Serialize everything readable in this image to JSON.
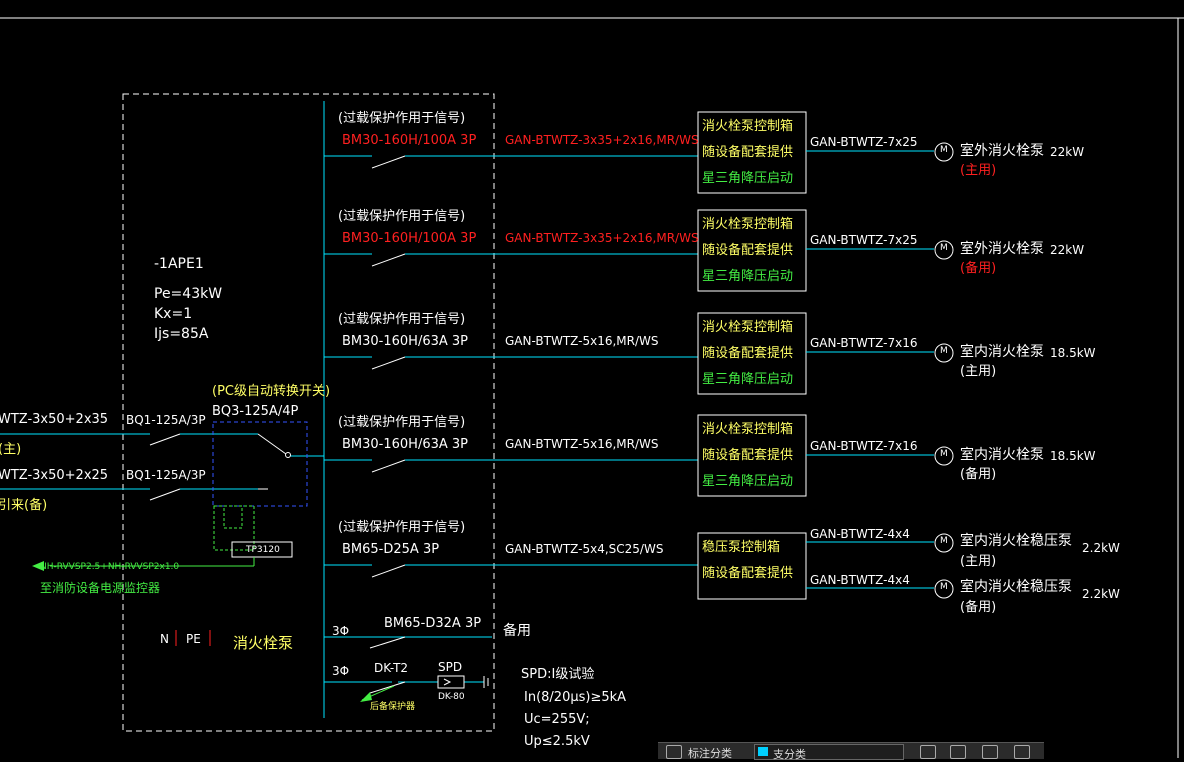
{
  "panel": {
    "name": "-1APE1",
    "pe": "Pe=43kW",
    "kx": "Kx=1",
    "ijs": "Ijs=85A",
    "title": "消火栓泵",
    "n_label": "N",
    "pe_label": "PE"
  },
  "incoming": [
    {
      "cable": "WTZ-3x50+2x35",
      "tag": "(主)",
      "breaker": "BQ1-125A/3P"
    },
    {
      "cable": "WTZ-3x50+2x25",
      "tag": "引来(备)",
      "breaker": "BQ1-125A/3P"
    }
  ],
  "ats": {
    "note": "(PC级自动转换开关)",
    "model": "BQ3-125A/4P",
    "ctrl": "TP3120"
  },
  "monitor": {
    "cable": "NH-RVVSP2.5+NH-RVVSP2x1.0",
    "note": "至消防设备电源监控器"
  },
  "circuits": [
    {
      "note": "(过载保护作用于信号)",
      "breaker": "BM30-160H/100A 3P",
      "cable": "GAN-BTWTZ-3x35+2x16,MR/WS",
      "red": true,
      "box": [
        "消火栓泵控制箱",
        "随设备配套提供",
        "星三角降压启动"
      ],
      "out_cable": "GAN-BTWTZ-7x25",
      "motor": "M",
      "load": "室外消火栓泵",
      "tag": "(主用)",
      "power": "22kW"
    },
    {
      "note": "(过载保护作用于信号)",
      "breaker": "BM30-160H/100A 3P",
      "cable": "GAN-BTWTZ-3x35+2x16,MR/WS",
      "red": true,
      "box": [
        "消火栓泵控制箱",
        "随设备配套提供",
        "星三角降压启动"
      ],
      "out_cable": "GAN-BTWTZ-7x25",
      "motor": "M",
      "load": "室外消火栓泵",
      "tag": "(备用)",
      "power": "22kW"
    },
    {
      "note": "(过载保护作用于信号)",
      "breaker": "BM30-160H/63A 3P",
      "cable": "GAN-BTWTZ-5x16,MR/WS",
      "red": false,
      "box": [
        "消火栓泵控制箱",
        "随设备配套提供",
        "星三角降压启动"
      ],
      "out_cable": "GAN-BTWTZ-7x16",
      "motor": "M",
      "load": "室内消火栓泵",
      "tag": "(主用)",
      "power": "18.5kW"
    },
    {
      "note": "(过载保护作用于信号)",
      "breaker": "BM30-160H/63A 3P",
      "cable": "GAN-BTWTZ-5x16,MR/WS",
      "red": false,
      "box": [
        "消火栓泵控制箱",
        "随设备配套提供",
        "星三角降压启动"
      ],
      "out_cable": "GAN-BTWTZ-7x16",
      "motor": "M",
      "load": "室内消火栓泵",
      "tag": "(备用)",
      "power": "18.5kW"
    },
    {
      "note": "(过载保护作用于信号)",
      "breaker": "BM65-D25A 3P",
      "cable": "GAN-BTWTZ-5x4,SC25/WS",
      "red": false,
      "box": [
        "稳压泵控制箱",
        "随设备配套提供"
      ],
      "loads": [
        {
          "out_cable": "GAN-BTWTZ-4x4",
          "motor": "M",
          "load": "室内消火栓稳压泵",
          "tag": "(主用)",
          "power": "2.2kW"
        },
        {
          "out_cable": "GAN-BTWTZ-4x4",
          "motor": "M",
          "load": "室内消火栓稳压泵",
          "tag": "(备用)",
          "power": "2.2kW"
        }
      ]
    }
  ],
  "spare": {
    "phase": "3Φ",
    "breaker": "BM65-D32A 3P",
    "label": "备用"
  },
  "spd": {
    "phase": "3Φ",
    "breaker": "DK-T2",
    "device": "SPD",
    "device_model": "DK-80",
    "fault_note": "后备保护器",
    "spec_title": "SPD:I级试验",
    "spec_in": "In(8/20μs)≥5kA",
    "spec_uc": "Uc=255V;",
    "spec_up": "Up≤2.5kV"
  },
  "statusbar": {
    "label": "标注分类",
    "layer": "支分类"
  },
  "colors": {
    "line": "#00e5ff",
    "text": "#ffffff",
    "yellow": "#ffff66",
    "red": "#ff2020",
    "green": "#44ee44"
  }
}
